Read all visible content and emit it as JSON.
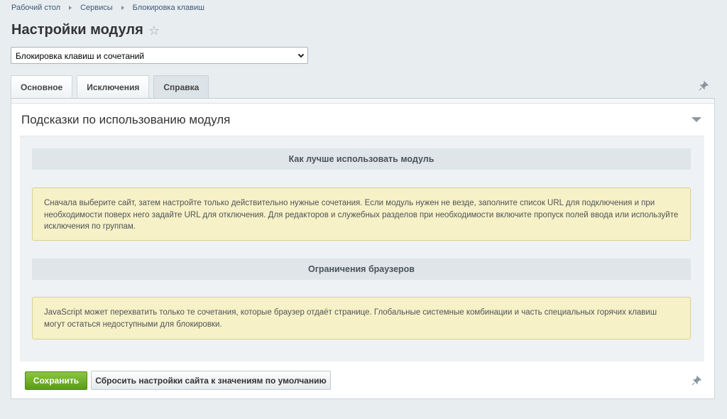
{
  "breadcrumbs": [
    "Рабочий стол",
    "Сервисы",
    "Блокировка клавиш"
  ],
  "page_title": "Настройки модуля",
  "module_select": {
    "value": "Блокировка клавиш и сочетаний"
  },
  "tabs": [
    {
      "label": "Основное",
      "active": false
    },
    {
      "label": "Исключения",
      "active": false
    },
    {
      "label": "Справка",
      "active": true
    }
  ],
  "section": {
    "title": "Подсказки по использованию модуля",
    "blocks": [
      {
        "heading": "Как лучше использовать модуль",
        "text": "Сначала выберите сайт, затем настройте только действительно нужные сочетания. Если модуль нужен не везде, заполните список URL для подключения и при необходимости поверх него задайте URL для отключения. Для редакторов и служебных разделов при необходимости включите пропуск полей ввода или используйте исключения по группам."
      },
      {
        "heading": "Ограничения браузеров",
        "text": "JavaScript может перехватить только те сочетания, которые браузер отдаёт странице. Глобальные системные комбинации и часть специальных горячих клавиш могут остаться недоступными для блокировки."
      }
    ]
  },
  "buttons": {
    "save": "Сохранить",
    "reset": "Сбросить настройки сайта к значениям по умолчанию"
  },
  "icons": {
    "favorite": "star-icon",
    "pin": "pin-icon",
    "collapse": "triangle-down-icon"
  },
  "colors": {
    "save_button": "#6aaa24",
    "note_background": "#f7f1c7",
    "heading_bar": "#dfe5e8"
  }
}
